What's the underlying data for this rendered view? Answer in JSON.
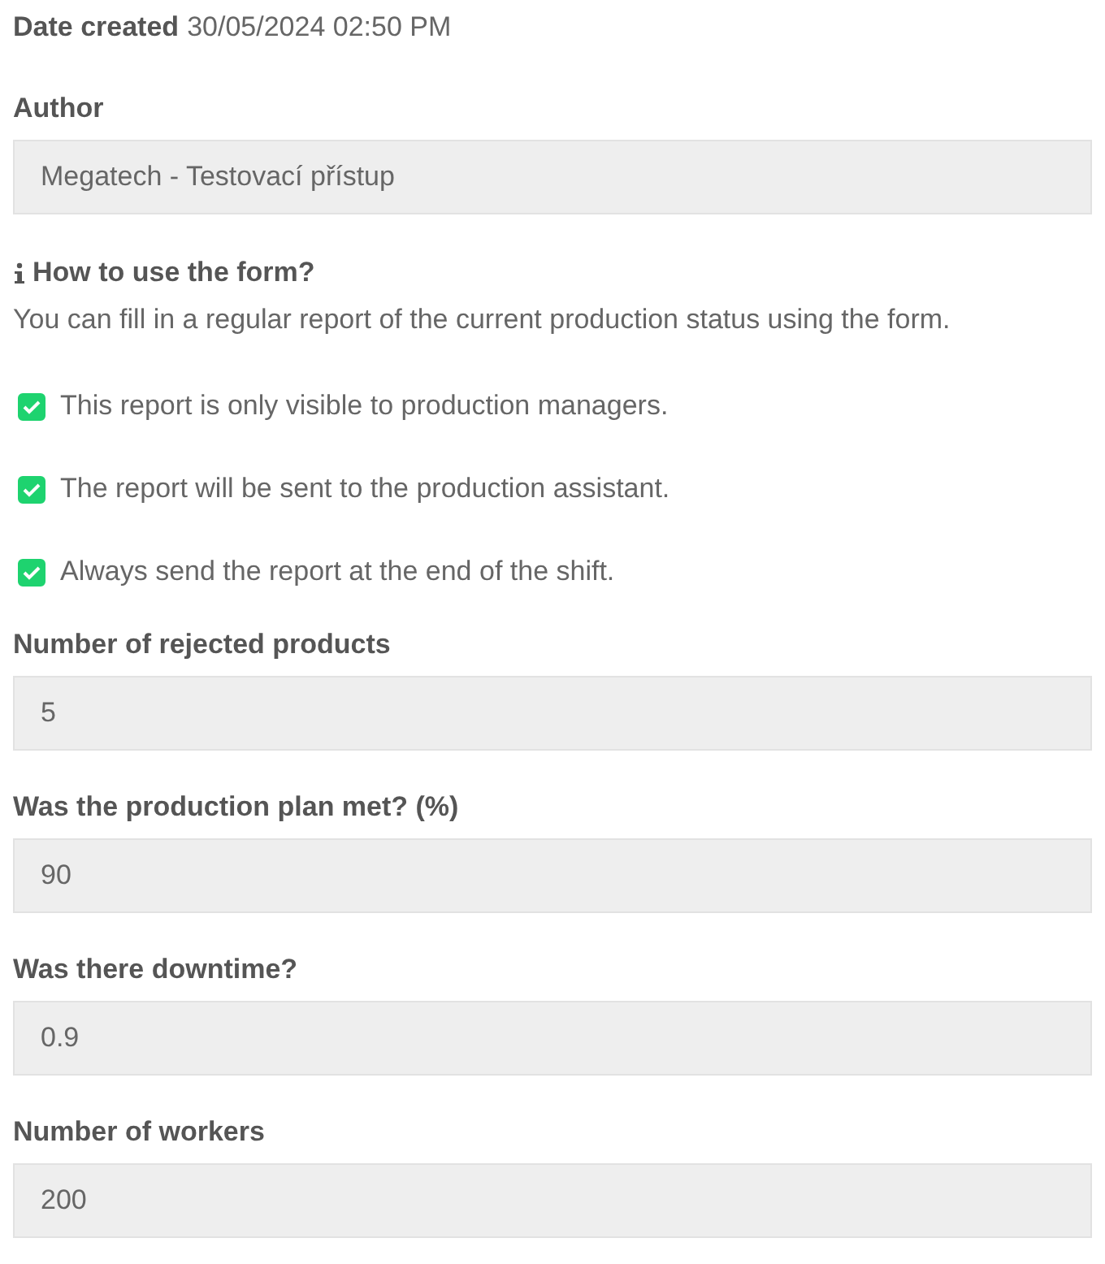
{
  "date_created": {
    "label": "Date created",
    "value": "30/05/2024 02:50 PM"
  },
  "author": {
    "label": "Author",
    "value": "Megatech - Testovací přístup"
  },
  "help": {
    "title": "How to use the form?",
    "text": "You can fill in a regular report of the current production status using the form."
  },
  "options": [
    {
      "label": "This report is only visible to production managers.",
      "checked": true
    },
    {
      "label": "The report will be sent to the production assistant.",
      "checked": true
    },
    {
      "label": "Always send the report at the end of the shift.",
      "checked": true
    }
  ],
  "fields": [
    {
      "label": "Number of rejected products",
      "value": "5"
    },
    {
      "label": "Was the production plan met? (%)",
      "value": "90"
    },
    {
      "label": "Was there downtime?",
      "value": "0.9"
    },
    {
      "label": "Number of workers",
      "value": "200"
    }
  ]
}
